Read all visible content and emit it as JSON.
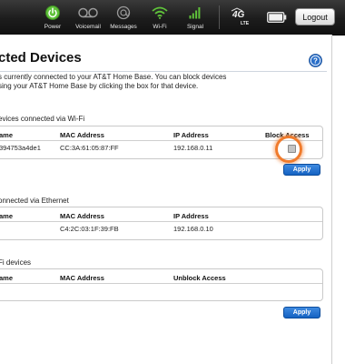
{
  "topbar": {
    "items": [
      {
        "label": "Power",
        "icon": "power-icon"
      },
      {
        "label": "Voicemail",
        "icon": "voicemail-icon"
      },
      {
        "label": "Messages",
        "icon": "messages-icon"
      },
      {
        "label": "Wi-Fi",
        "icon": "wifi-icon"
      },
      {
        "label": "Signal",
        "icon": "signal-icon"
      }
    ],
    "network_badge": "4G",
    "network_sub": "LTE",
    "logout_label": "Logout",
    "colors": {
      "accent_green": "#5fc23a",
      "bar_bg": "#1c1c1c"
    }
  },
  "page": {
    "title": "cted Devices",
    "description_line1": "s currently connected to your AT&T Home Base. You can block devices",
    "description_line2": "sing your AT&T Home Base by clicking the box for that device."
  },
  "wifi_section": {
    "label": "evices connected via Wi-Fi",
    "headers": {
      "name": "ame",
      "mac": "MAC Address",
      "ip": "IP Address",
      "block": "Block Access"
    },
    "rows": [
      {
        "name": "394753a4de1",
        "mac": "CC:3A:61:05:87:FF",
        "ip": "192.168.0.11",
        "blocked": false
      }
    ],
    "apply_label": "Apply"
  },
  "ethernet_section": {
    "label": "onnected via Ethernet",
    "headers": {
      "name": "ame",
      "mac": "MAC Address",
      "ip": "IP Address"
    },
    "rows": [
      {
        "name": "",
        "mac": "C4:2C:03:1F:39:FB",
        "ip": "192.168.0.10"
      }
    ]
  },
  "blocked_section": {
    "label": "Fi devices",
    "headers": {
      "name": "ame",
      "mac": "MAC Address",
      "unblock": "Unblock Access"
    },
    "rows": [],
    "apply_label": "Apply"
  },
  "colors": {
    "apply_blue": "#1f6fd1",
    "highlight_orange": "#f07b2c",
    "help_blue": "#2a6fc9"
  }
}
